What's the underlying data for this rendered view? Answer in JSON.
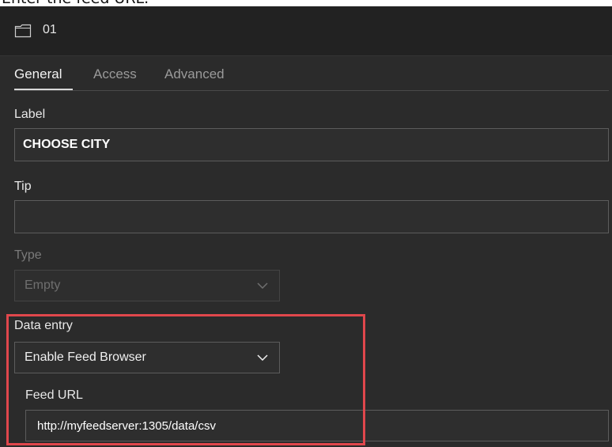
{
  "caption": "Enter the feed URL.",
  "window": {
    "title": "01",
    "icon": "folder-icon"
  },
  "tabs": [
    {
      "label": "General",
      "active": true
    },
    {
      "label": "Access",
      "active": false
    },
    {
      "label": "Advanced",
      "active": false
    }
  ],
  "fields": {
    "label": {
      "title": "Label",
      "value": "CHOOSE CITY"
    },
    "tip": {
      "title": "Tip",
      "value": ""
    },
    "type": {
      "title": "Type",
      "selected": "Empty",
      "disabled": true
    },
    "data_entry": {
      "title": "Data entry",
      "selected": "Enable Feed Browser"
    },
    "feed_url": {
      "title": "Feed URL",
      "value": "http://myfeedserver:1305/data/csv"
    }
  },
  "colors": {
    "background": "#2b2b2b",
    "title_bar": "#222222",
    "highlight": "#e0474c",
    "input_border": "#5c5c5c",
    "active_tab": "#f2f2f2",
    "inactive_tab": "#9a9a9a"
  }
}
